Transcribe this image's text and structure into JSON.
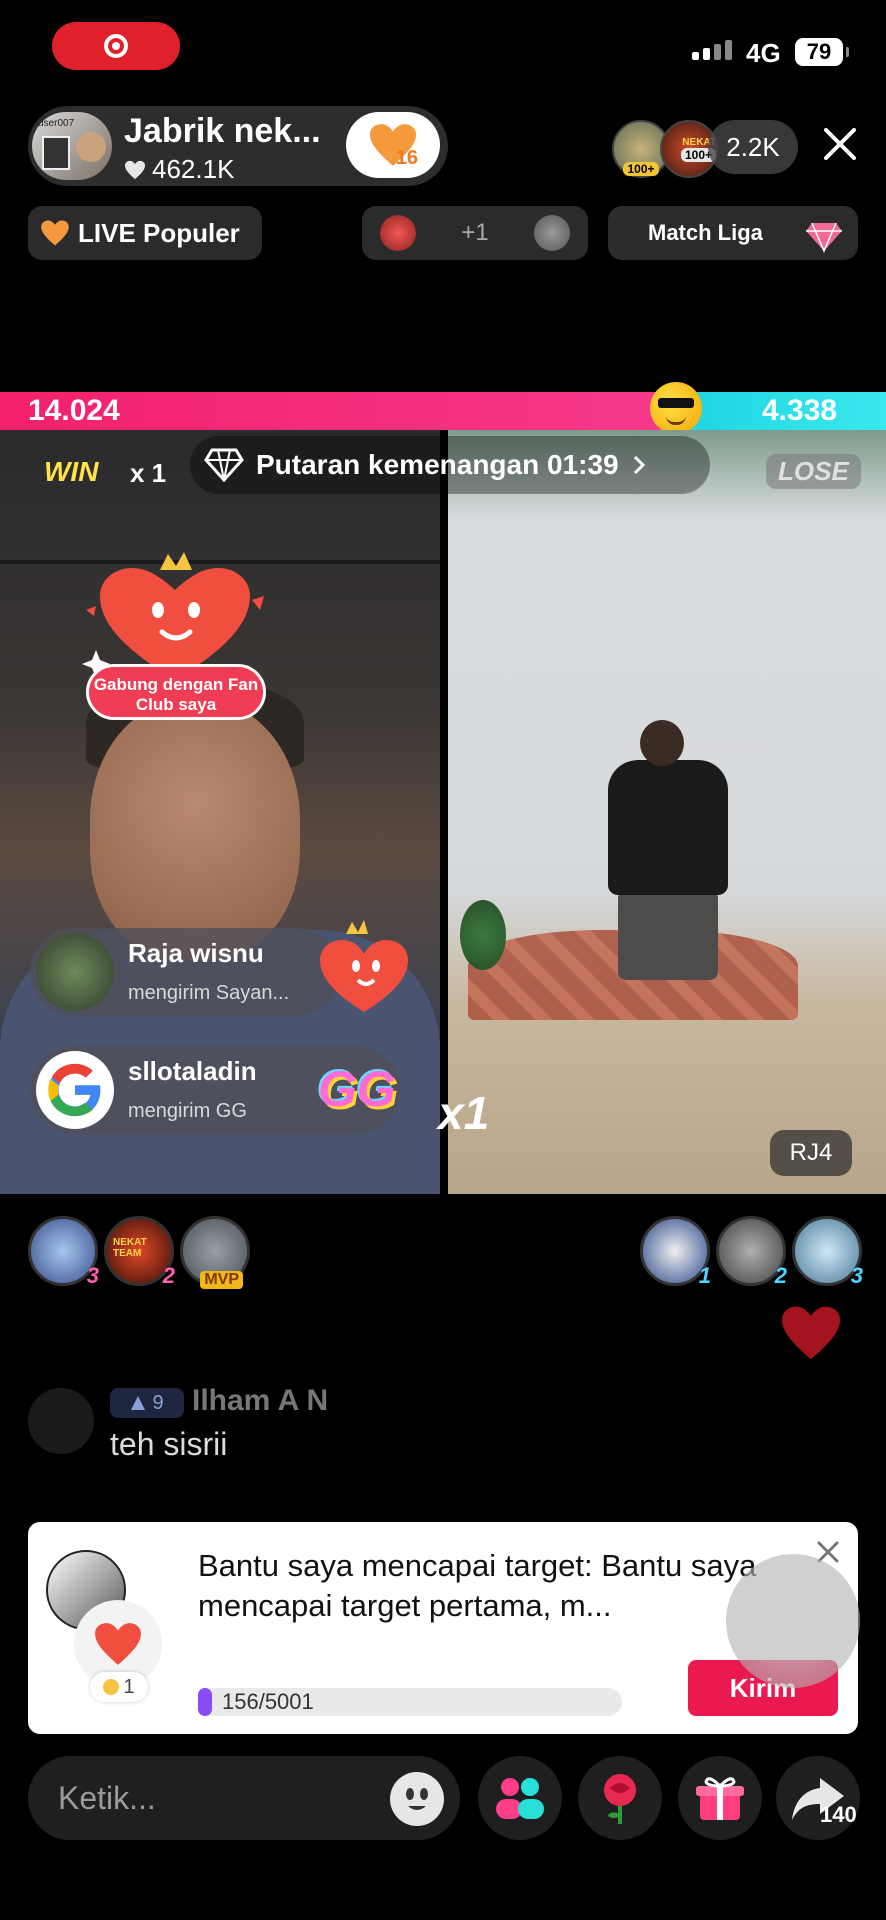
{
  "status_bar": {
    "network": "4G",
    "battery": "79"
  },
  "host": {
    "name": "Jabrik nek...",
    "likes": "462.1K",
    "fan_level": "16",
    "avatar_tag": "user007"
  },
  "viewers": {
    "count": "2.2K",
    "badges": [
      "100+",
      "100+"
    ],
    "badge_label": "NEKAT"
  },
  "pills": {
    "live_populer": "LIVE Populer",
    "gift_more": "+1",
    "match_liga": "Match Liga"
  },
  "battle": {
    "score_left": "14.024",
    "score_right": "4.338",
    "win_label": "WIN",
    "win_multiplier": "x 1",
    "round_text": "Putaran kemenangan 01:39",
    "lose_label": "LOSE",
    "left_multiplier": "x1",
    "right_tag": "RJ4"
  },
  "fan_club_sticker": "Gabung dengan Fan Club saya",
  "gift_notifications": [
    {
      "user": "Raja wisnu",
      "action": "mengirim Sayan..."
    },
    {
      "user": "sllotaladin",
      "action": "mengirim GG",
      "gift_label": "GG"
    }
  ],
  "top_fans_left": [
    {
      "rank": "3"
    },
    {
      "rank": "2",
      "label": "NEKAT TEAM"
    },
    {
      "rank": "MVP"
    }
  ],
  "top_fans_right": [
    {
      "rank": "1"
    },
    {
      "rank": "2"
    },
    {
      "rank": "3"
    }
  ],
  "chat": [
    {
      "level": "9",
      "user": "Ilham A N",
      "text": "teh sisrii"
    }
  ],
  "target_card": {
    "text": "Bantu saya mencapai target: Bantu saya mencapai target pertama, m...",
    "coins": "1",
    "progress_label": "156/5001",
    "progress_value": 156,
    "progress_max": 5001,
    "send_button": "Kirim"
  },
  "bottom_bar": {
    "input_placeholder": "Ketik...",
    "share_count": "140"
  },
  "colors": {
    "accent_pink": "#f3206c",
    "accent_cyan": "#1fd4e0",
    "kirim_red": "#ea1a51",
    "rec_red": "#e0212b"
  }
}
